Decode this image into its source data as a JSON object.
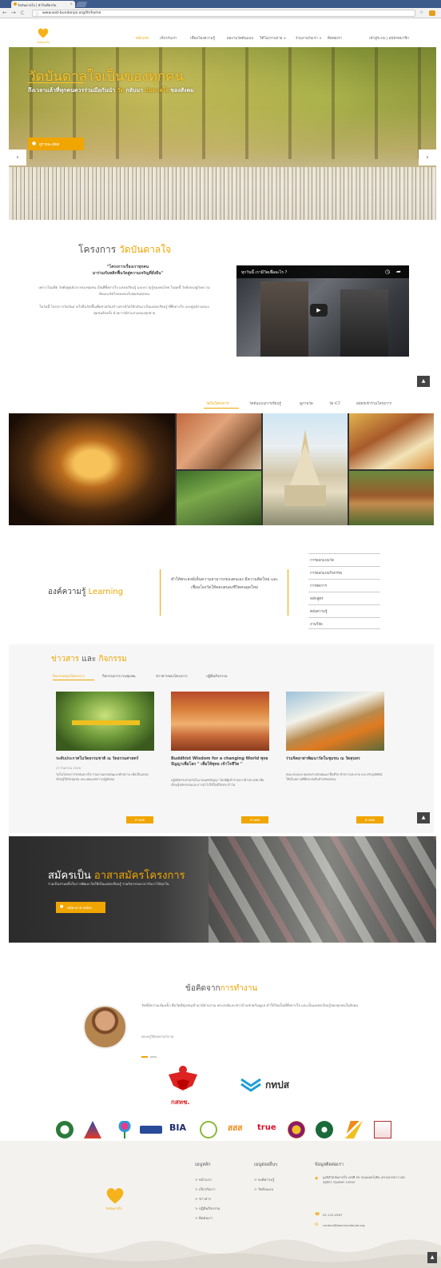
{
  "browser": {
    "tab_title": "วัดบันดาลใจ | หัวใจเดียวกัน",
    "tab_close": "×",
    "url": "www.wat-bundanjai.org/th/home",
    "back": "←",
    "forward": "→",
    "reload": "C",
    "star": "☆"
  },
  "nav": {
    "items": [
      "หน้าแรก",
      "เกี่ยวกับเรา",
      "เชื่อมโยงความรู้",
      "ผลงานวัดต้นแบบ",
      "วิดีโอ/ภาพถ่าย ∨",
      "ร่วมงานกับเรา ∨",
      "ติดต่อเรา"
    ],
    "right": "เข้าสู่ระบบ | สมัครสมาชิก",
    "logo_text": "วัดบันดาลใจ"
  },
  "hero": {
    "title": "วัดบันดาลใจเป็นของทุกคน",
    "subtitle_a": "ถึงเวลาแล้วที่ทุกคนควรร่วมมือกันนำ ",
    "subtitle_hl1": "วัด",
    "subtitle_b": " กลับมา ",
    "subtitle_hl2": "บันดาลใจ",
    "subtitle_c": " ของสังคม",
    "button": "ดูรายละเอียด",
    "prev": "‹",
    "next": "›"
  },
  "project": {
    "title_a": "โครงการ ",
    "title_hl": "วัดบันดาลใจ",
    "sub1": "\"โครงการเรื่องเราทุกคน",
    "sub2": "มาร่วมกันพลิกฟื้นวัดสู่ความเจริญที่ยั่งยืน\"",
    "p1": "เพราะในอดีต วัดคือศูนย์กลางของชุมชน เป็นที่พึ่งทางใจ แหล่งเรียนรู้ และความรู้ของคนไทย ในยุคนี้ วัดยังคงอยู่กับความคิดและจิตใจของคนในชุมชนทุกคน",
    "p2": "ในวันนี้ โครงการวัดบันดาลใจจึงเกิดขึ้นเพื่อช่วยกันสร้างสรรค์วัดให้กลับมาเป็นแหล่งเรียนรู้ ที่พึ่งทางใจ และศูนย์รวมของชุมชนอีกครั้ง ด้วยการมีส่วนร่วมของทุกฝ่าย",
    "video_title": "ทุกวันนี้ เรามีวัดเพื่ออะไร ?",
    "video_play": "▶"
  },
  "gallery": {
    "tabs": [
      "วัดในโครงการ",
      "วัดต้นแบบการเรียนรู้",
      "ดูภาพวัด",
      "วัด ICT",
      "สมัครเข้าร่วมโครงการ"
    ]
  },
  "knowledge": {
    "title_a": "องค์ความรู้ ",
    "title_hl": "Learning",
    "text": "ทำให้พระสงฆ์เห็นความสามารถของตนเอง มีความคิดใหม่ และเชื่อมโยงวัดให้ตอบสนองชีวิตคนยุคใหม่",
    "links": [
      "การออกแบบวัด",
      "การออกแบบกิจกรรม",
      "การจัดการ",
      "หลักสูตร",
      "คลังความรู้",
      "งานวิจัย"
    ]
  },
  "news": {
    "title_a": "ข่าวสาร ",
    "title_mid": "และ",
    "title_b": " กิจกรรม",
    "tabs": [
      "กิจกรรมของโครงการ",
      "กิจกรรมการงานชุมชน",
      "ข่าวสารของโครงการ",
      "ปฏิทินกิจกรรม"
    ],
    "cards": [
      {
        "title": "ระดับประกาศในวัดธรรมชาติ ณ วัดธรรมศาสตร์",
        "date": "27 กันยายน 2558",
        "text": "วัดในโครงการวัดบันดาลใจ ร่วมงานอบรมพัฒนาศักยภาพ เพื่อเป็นแหล่งเรียนรู้ให้กับชุมชน และเผยแพร่ความรู้สู่สังคม",
        "more": "อ่านต่อ"
      },
      {
        "title": "Buddhist Wisdom for a changing World พุทธปัญญาเพื่อโลก \" เพื่อให้พุทธ เข้าใจชีวิต \"",
        "date": "",
        "text": "ปฏิบัติธรรมร่วมกันในงานพุทธปัญญา โดยมีผู้เข้าร่วมจากทั่วประเทศ เพื่อเรียนรู้หลักธรรมและการนำไปใช้ในชีวิตประจำวัน",
        "more": "อ่านต่อ"
      },
      {
        "title": "ร่วมจิตอาสาพัฒนาวัดในชุมชน ณ วัดสุนทร",
        "date": "",
        "text": "คณะสงฆ์และชุมชนร่วมกันพัฒนาพื้นที่วัด ทำความสะอาด และปรับภูมิทัศน์ ให้เป็นสถานที่ที่สงบร่มรื่นสำหรับทุกคน",
        "more": "อ่านต่อ"
      }
    ]
  },
  "volunteer": {
    "title_a": "สมัครเป็น ",
    "title_hl": "อาสาสมัครโครงการ",
    "text": "ร่วมเป็นส่วนหนึ่งในการพัฒนาวัดให้เป็นแหล่งเรียนรู้ ร่วมกิจกรรมอาสากับเราได้ทุกวัน",
    "button": "สมัครอาสาสมัคร"
  },
  "testimonial": {
    "title_a": "ข้อคิดจาก",
    "title_hl": "การทำงาน",
    "text": "วัดที่มีความเข้มแข็ง คือวัดที่ชุมชนเข้ามามีส่วนร่วม พระสงฆ์และชาวบ้านช่วยกันดูแล ทำให้วัดเป็นที่พึ่งทางใจ และเป็นแหล่งเรียนรู้ของทุกคนในสังคม",
    "author": "พระครูวิจิตรธรรมวิภาค"
  },
  "logos": {
    "nbtc_text": "กทปส",
    "nbtc_sub": "กสทช.",
    "partners": [
      "BIA",
      "สสส",
      "true"
    ]
  },
  "footer": {
    "col1_head": "เมนูหลัก",
    "col1_links": [
      "> หน้าแรก",
      "> เกี่ยวกับเรา",
      "> ข่าวสาร",
      "> ปฏิทินกิจกรรม",
      "> ติดต่อเรา"
    ],
    "col2_head": "เมนูย่อยอื่นๆ",
    "col2_links": [
      "> องค์ความรู้",
      "> วัดต้นแบบ"
    ],
    "col3_head": "ข้อมูลติดต่อเรา",
    "address": "มูลนิธิวัดบันดาลใจ เลขที่ 99 ถนนพหลโยธิน แขวงลาดยาว เขตจตุจักร กรุงเทพฯ 10900",
    "phone": "02-123-4567",
    "email": "contact@wat-bundanjai.org",
    "logo_text": "วัดบันดาลใจ",
    "scroll_top": "▲"
  },
  "colors": {
    "accent": "#f0a500",
    "text": "#555555"
  }
}
